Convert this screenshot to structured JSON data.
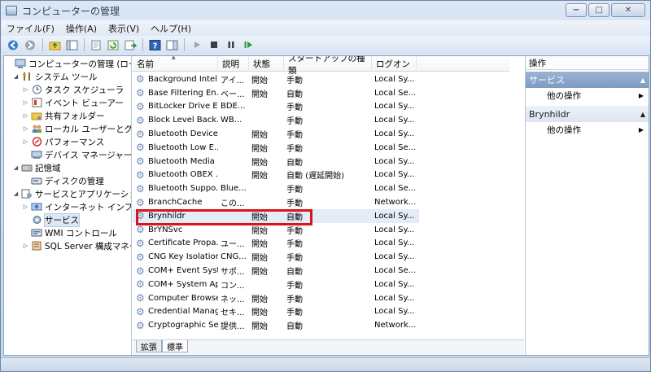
{
  "window": {
    "title": "コンピューターの管理",
    "controls": {
      "minimize": "−",
      "maximize": "□",
      "close": "✕"
    }
  },
  "menu": [
    "ファイル(F)",
    "操作(A)",
    "表示(V)",
    "ヘルプ(H)"
  ],
  "toolbar": {
    "icons": [
      "back-icon",
      "forward-icon",
      "up-folder-icon",
      "show-tree-icon",
      "export-icon",
      "refresh-icon",
      "export-list-icon",
      "help-icon",
      "action-pane-icon",
      "play-icon",
      "stop-icon",
      "pause-icon",
      "restart-icon"
    ]
  },
  "tree": [
    {
      "label": "コンピューターの管理 (ローカル",
      "level": 0,
      "icon": "computer-icon",
      "twisty": ""
    },
    {
      "label": "システム ツール",
      "level": 1,
      "icon": "tools-icon",
      "twisty": "◢"
    },
    {
      "label": "タスク スケジューラ",
      "level": 2,
      "icon": "clock-icon",
      "twisty": "▷"
    },
    {
      "label": "イベント ビューアー",
      "level": 2,
      "icon": "event-viewer-icon",
      "twisty": "▷"
    },
    {
      "label": "共有フォルダー",
      "level": 2,
      "icon": "shared-folder-icon",
      "twisty": "▷"
    },
    {
      "label": "ローカル ユーザーとグル",
      "level": 2,
      "icon": "users-icon",
      "twisty": "▷"
    },
    {
      "label": "パフォーマンス",
      "level": 2,
      "icon": "performance-icon",
      "twisty": "▷"
    },
    {
      "label": "デバイス マネージャー",
      "level": 2,
      "icon": "device-manager-icon",
      "twisty": ""
    },
    {
      "label": "記憶域",
      "level": 1,
      "icon": "storage-icon",
      "twisty": "◢"
    },
    {
      "label": "ディスクの管理",
      "level": 2,
      "icon": "disk-icon",
      "twisty": ""
    },
    {
      "label": "サービスとアプリケーション",
      "level": 1,
      "icon": "services-apps-icon",
      "twisty": "◢"
    },
    {
      "label": "インターネット インフォ",
      "level": 2,
      "icon": "iis-icon",
      "twisty": "▷"
    },
    {
      "label": "サービス",
      "level": 2,
      "icon": "services-icon",
      "twisty": "",
      "selected": true
    },
    {
      "label": "WMI コントロール",
      "level": 2,
      "icon": "wmi-icon",
      "twisty": ""
    },
    {
      "label": "SQL Server 構成マネージ",
      "level": 2,
      "icon": "sql-server-icon",
      "twisty": "▷"
    }
  ],
  "columns": [
    "名前",
    "説明",
    "状態",
    "スタートアップの種類",
    "ログオン"
  ],
  "services": [
    {
      "name": "Background Intel...",
      "desc": "アイ...",
      "state": "開始",
      "startup": "手動",
      "logon": "Local Sy..."
    },
    {
      "name": "Base Filtering En...",
      "desc": "ベー...",
      "state": "開始",
      "startup": "自動",
      "logon": "Local Se..."
    },
    {
      "name": "BitLocker Drive E...",
      "desc": "BDE...",
      "state": "",
      "startup": "手動",
      "logon": "Local Sy..."
    },
    {
      "name": "Block Level Back...",
      "desc": "WB...",
      "state": "",
      "startup": "手動",
      "logon": "Local Sy..."
    },
    {
      "name": "Bluetooth Device...",
      "desc": "",
      "state": "開始",
      "startup": "手動",
      "logon": "Local Sy..."
    },
    {
      "name": "Bluetooth Low E...",
      "desc": "",
      "state": "開始",
      "startup": "手動",
      "logon": "Local Se..."
    },
    {
      "name": "Bluetooth Media ...",
      "desc": "",
      "state": "開始",
      "startup": "自動",
      "logon": "Local Sy..."
    },
    {
      "name": "Bluetooth OBEX ...",
      "desc": "",
      "state": "開始",
      "startup": "自動 (遅延開始)",
      "logon": "Local Sy..."
    },
    {
      "name": "Bluetooth Suppo...",
      "desc": "Blue...",
      "state": "",
      "startup": "手動",
      "logon": "Local Se..."
    },
    {
      "name": "BranchCache",
      "desc": "この...",
      "state": "",
      "startup": "手動",
      "logon": "Network..."
    },
    {
      "name": "Brynhildr",
      "desc": "",
      "state": "開始",
      "startup": "自動",
      "logon": "Local Sy...",
      "highlight": true
    },
    {
      "name": "BrYNSvc",
      "desc": "",
      "state": "開始",
      "startup": "手動",
      "logon": "Local Sy..."
    },
    {
      "name": "Certificate Propa...",
      "desc": "ユー...",
      "state": "開始",
      "startup": "手動",
      "logon": "Local Sy..."
    },
    {
      "name": "CNG Key Isolation",
      "desc": "CNG...",
      "state": "開始",
      "startup": "手動",
      "logon": "Local Sy..."
    },
    {
      "name": "COM+ Event Syst...",
      "desc": "サポ...",
      "state": "開始",
      "startup": "自動",
      "logon": "Local Se..."
    },
    {
      "name": "COM+ System Ap...",
      "desc": "コン...",
      "state": "",
      "startup": "手動",
      "logon": "Local Sy..."
    },
    {
      "name": "Computer Browser",
      "desc": "ネッ...",
      "state": "開始",
      "startup": "手動",
      "logon": "Local Sy..."
    },
    {
      "name": "Credential Manager",
      "desc": "セキ...",
      "state": "開始",
      "startup": "手動",
      "logon": "Local Sy..."
    },
    {
      "name": "Cryptographic Se...",
      "desc": "提供...",
      "state": "開始",
      "startup": "自動",
      "logon": "Network..."
    }
  ],
  "tabs": [
    "拡張",
    "標準"
  ],
  "actions": {
    "header": "操作",
    "sections": [
      {
        "title": "サービス",
        "style": "blue",
        "items": [
          "他の操作"
        ]
      },
      {
        "title": "Brynhildr",
        "style": "plain",
        "items": [
          "他の操作"
        ]
      }
    ]
  }
}
